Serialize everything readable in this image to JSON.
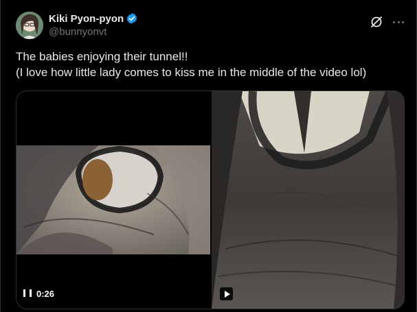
{
  "author": {
    "display_name": "Kiki Pyon-pyon",
    "handle": "@bunnyonvt",
    "verified": true,
    "avatar_icon": "avatar-image"
  },
  "actions": {
    "grok_icon": "grok-icon",
    "more_icon": "more-options-icon"
  },
  "tweet": {
    "lines": [
      "The babies enjoying their tunnel!!",
      "(I love how little lady comes to kiss me in the middle of the video lol)"
    ]
  },
  "media": {
    "video_1": {
      "state": "playing",
      "elapsed": "0:26"
    },
    "video_2": {
      "state": "paused"
    }
  },
  "colors": {
    "background": "#000000",
    "text_primary": "#e7e9ea",
    "text_secondary": "#71767b",
    "verified_blue": "#1d9bf0",
    "border": "#2f3336"
  }
}
